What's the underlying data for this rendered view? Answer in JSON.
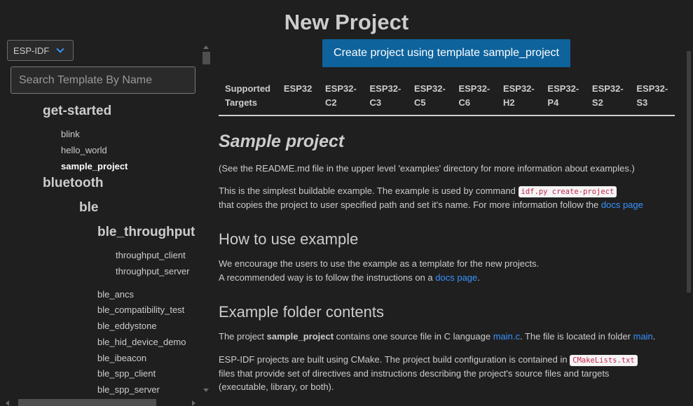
{
  "page": {
    "title": "New Project"
  },
  "sidebar": {
    "framework_select": "ESP-IDF",
    "search": {
      "placeholder": "Search Template By Name",
      "value": ""
    },
    "tree": {
      "get_started": "get-started",
      "blink": "blink",
      "hello_world": "hello_world",
      "sample_project": "sample_project",
      "bluetooth": "bluetooth",
      "ble": "ble",
      "ble_throughput": "ble_throughput",
      "throughput_client": "throughput_client",
      "throughput_server": "throughput_server",
      "ble_ancs": "ble_ancs",
      "ble_compatibility_test": "ble_compatibility_test",
      "ble_eddystone": "ble_eddystone",
      "ble_hid_device_demo": "ble_hid_device_demo",
      "ble_ibeacon": "ble_ibeacon",
      "ble_spp_client": "ble_spp_client",
      "ble_spp_server": "ble_spp_server"
    }
  },
  "main": {
    "create_button": "Create project using template sample_project",
    "targets": {
      "header": [
        "Supported",
        "Targets"
      ],
      "columns": [
        [
          "ESP32"
        ],
        [
          "ESP32-",
          "C2"
        ],
        [
          "ESP32-",
          "C3"
        ],
        [
          "ESP32-",
          "C5"
        ],
        [
          "ESP32-",
          "C6"
        ],
        [
          "ESP32-",
          "H2"
        ],
        [
          "ESP32-",
          "P4"
        ],
        [
          "ESP32-",
          "S2"
        ],
        [
          "ESP32-",
          "S3"
        ]
      ]
    },
    "readme": {
      "title": "Sample project",
      "intro": "(See the README.md file in the upper level 'examples' directory for more information about examples.)",
      "p1_a": "This is the simplest buildable example. The example is used by command ",
      "p1_code": "idf.py create-project",
      "p1_b": "that copies the project to user specified path and set it's name. For more information follow the ",
      "p1_link": "docs page",
      "h_how": "How to use example",
      "how_1": "We encourage the users to use the example as a template for the new projects.",
      "how_2a": "A recommended way is to follow the instructions on a ",
      "how_2_link": "docs page",
      "how_2b": ".",
      "h_folder": "Example folder contents",
      "f1_a": "The project ",
      "f1_bold": "sample_project",
      "f1_b": " contains one source file in C language ",
      "f1_link1": "main.c",
      "f1_c": ". The file is located in folder ",
      "f1_link2": "main",
      "f1_d": ".",
      "f2_a": "ESP-IDF projects are built using CMake. The project build configuration is contained in ",
      "f2_code": "CMakeLists.txt",
      "f2_b": "files that provide set of directives and instructions describing the project's source files and targets",
      "f2_c": "(executable, library, or both)."
    }
  },
  "colors": {
    "accent": "#0e639c",
    "link": "#3794ff",
    "background": "#1f1f1f"
  }
}
